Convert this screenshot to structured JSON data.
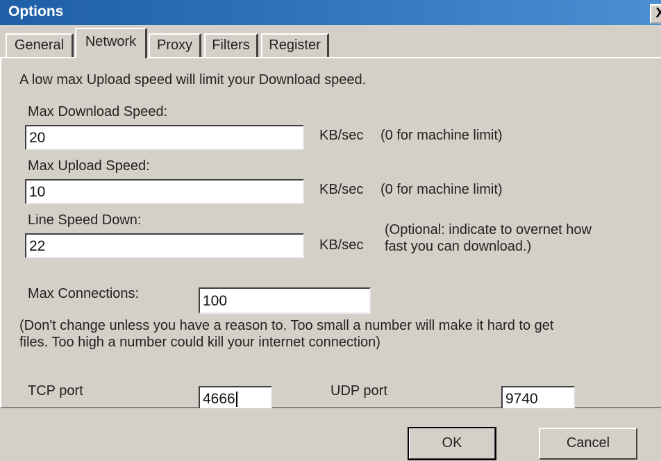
{
  "window": {
    "title": "Options",
    "close_glyph": "X"
  },
  "tabs": [
    {
      "label": "General",
      "active": false
    },
    {
      "label": "Network",
      "active": true
    },
    {
      "label": "Proxy",
      "active": false
    },
    {
      "label": "Filters",
      "active": false
    },
    {
      "label": "Register",
      "active": false
    }
  ],
  "network": {
    "intro_text": "A low max Upload speed will limit your Download speed.",
    "max_download": {
      "label": "Max Download Speed:",
      "value": "20",
      "unit": "KB/sec",
      "hint": "(0 for machine limit)"
    },
    "max_upload": {
      "label": "Max Upload Speed:",
      "value": "10",
      "unit": "KB/sec",
      "hint": "(0 for machine limit)"
    },
    "line_speed_down": {
      "label": "Line Speed Down:",
      "value": "22",
      "unit": "KB/sec",
      "hint_line1": "(Optional: indicate to overnet how",
      "hint_line2": "fast you can download.)"
    },
    "max_connections": {
      "label": "Max Connections:",
      "value": "100",
      "note_line1": "(Don't change unless you have a reason to. Too small a number will make it hard to get",
      "note_line2": "files. Too high a number could kill your internet connection)"
    },
    "tcp_port": {
      "label": "TCP port",
      "value": "4666"
    },
    "udp_port": {
      "label": "UDP port",
      "value": "9740"
    }
  },
  "buttons": {
    "ok": "OK",
    "cancel": "Cancel"
  },
  "colors": {
    "titlebar": "#2f73bd",
    "dialog_face": "#d4d0c8",
    "field_bg": "#ffffff"
  }
}
